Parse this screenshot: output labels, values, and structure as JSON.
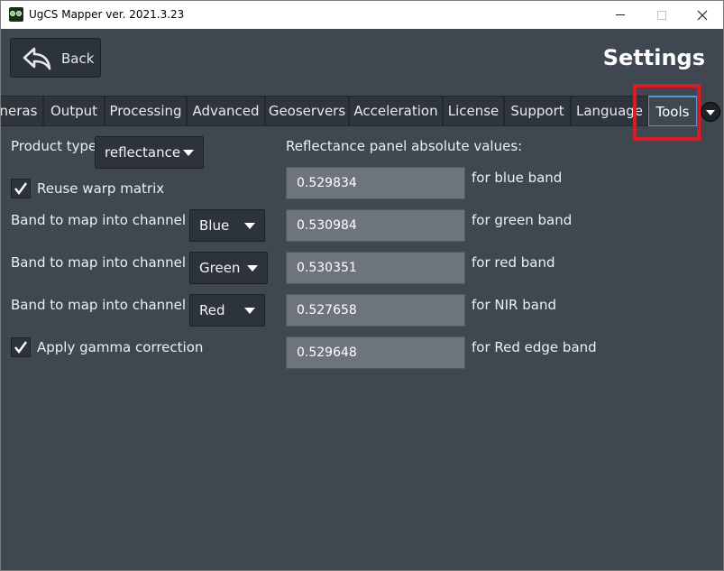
{
  "window": {
    "title": "UgCS Mapper ver. 2021.3.23",
    "icon": "ugcs-app-icon"
  },
  "header": {
    "back_label": "Back",
    "page_title": "Settings"
  },
  "tabs": [
    {
      "label": "neras"
    },
    {
      "label": "Output"
    },
    {
      "label": "Processing"
    },
    {
      "label": "Advanced"
    },
    {
      "label": "Geoservers"
    },
    {
      "label": "Acceleration"
    },
    {
      "label": "License"
    },
    {
      "label": "Support"
    },
    {
      "label": "Language"
    },
    {
      "label": "Tools",
      "active": true
    }
  ],
  "tools": {
    "product_type_label": "Product type",
    "product_type_value": "reflectance",
    "reuse_warp_label": "Reuse warp matrix",
    "reuse_warp_checked": true,
    "band0_label": "Band to map into channel 0",
    "band0_value": "Blue",
    "band1_label": "Band to map into channel 1",
    "band1_value": "Green",
    "band2_label": "Band to map into channel 2",
    "band2_value": "Red",
    "gamma_label": "Apply gamma correction",
    "gamma_checked": true,
    "reflectance_title": "Reflectance panel absolute values:",
    "reflectance": [
      {
        "value": "0.529834",
        "label": "for blue band"
      },
      {
        "value": "0.530984",
        "label": "for green band"
      },
      {
        "value": "0.530351",
        "label": "for red band"
      },
      {
        "value": "0.527658",
        "label": "for NIR band"
      },
      {
        "value": "0.529648",
        "label": "for Red edge band"
      }
    ]
  },
  "colors": {
    "background": "#3f4750",
    "highlight": "#e3171f",
    "active_tab_border": "#4c9ad6"
  }
}
